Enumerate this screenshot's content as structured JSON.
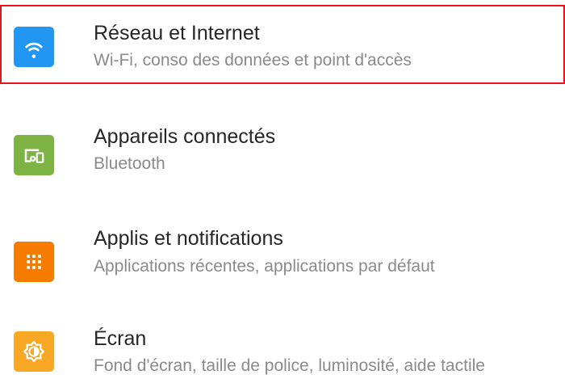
{
  "settings": {
    "items": [
      {
        "title": "Réseau et Internet",
        "subtitle": "Wi-Fi, conso des données et point d'accès",
        "icon": "wifi-icon",
        "color": "#2196f3",
        "highlighted": true
      },
      {
        "title": "Appareils connectés",
        "subtitle": "Bluetooth",
        "icon": "devices-icon",
        "color": "#7cb342",
        "highlighted": false
      },
      {
        "title": "Applis et notifications",
        "subtitle": "Applications récentes, applications par défaut",
        "icon": "apps-grid-icon",
        "color": "#f57c00",
        "highlighted": false
      },
      {
        "title": "Écran",
        "subtitle": "Fond d'écran, taille de police, luminosité, aide tactile",
        "icon": "brightness-icon",
        "color": "#f9a825",
        "highlighted": false
      }
    ]
  },
  "highlight_color": "#e8141b"
}
